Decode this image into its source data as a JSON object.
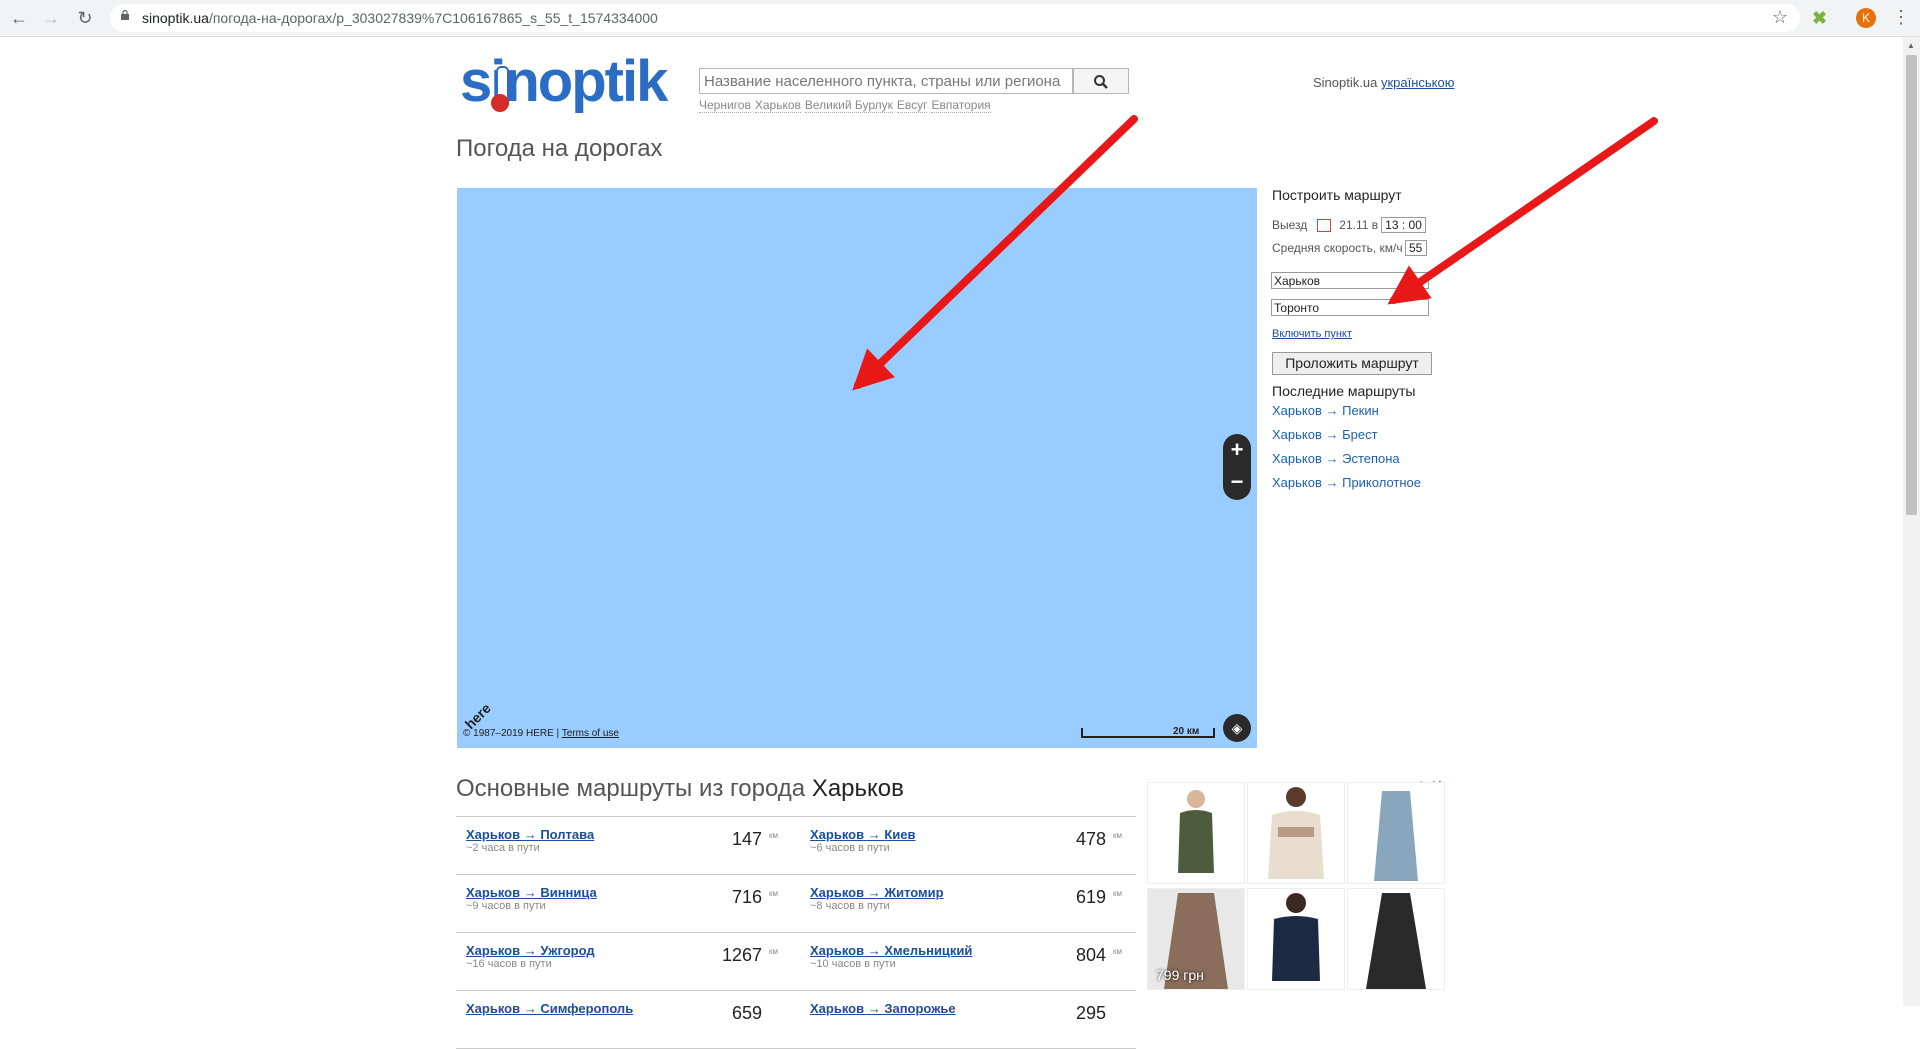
{
  "browser": {
    "url_domain": "sinoptik.ua",
    "url_path": "/погода-на-дорогах/p_303027839%7C106167865_s_55_t_1574334000",
    "profile_initial": "K"
  },
  "header": {
    "logo_text": "sinoptik",
    "search_placeholder": "Название населенного пункта, страны или региона",
    "quick_cities": [
      "Чернигов",
      "Харьков",
      "Великий Бурлук",
      "Евсуг",
      "Евпатория"
    ],
    "site_label": "Sinoptik.ua",
    "lang_link": "українською"
  },
  "page_title": "Погода на дорогах",
  "map": {
    "copyright": "© 1987–2019 HERE |",
    "terms_link": "Terms of use",
    "scale_label": "20 км",
    "here_logo": "here",
    "zoom_in": "+",
    "zoom_out": "−"
  },
  "route_form": {
    "title": "Построить маршрут",
    "depart_label": "Выезд",
    "depart_date": "21.11 в",
    "depart_hour": "13",
    "depart_sep": ":",
    "depart_min": "00",
    "speed_label": "Средняя скорость, км/ч",
    "speed_value": "55",
    "from_value": "Харьков",
    "to_value": "Торонто",
    "add_point": "Включить пункт",
    "build_button": "Проложить маршрут"
  },
  "recent": {
    "title": "Последние маршруты",
    "items": [
      "Харьков → Пекин",
      "Харьков → Брест",
      "Харьков → Эстепона",
      "Харьков → Приколотное"
    ]
  },
  "routes": {
    "title_prefix": "Основные маршруты из города",
    "title_city": "Харьков",
    "km_unit": "км",
    "rows": [
      [
        {
          "link": "Харьков → Полтава",
          "time": "~2 часа в пути",
          "dist": "147"
        },
        {
          "link": "Харьков → Киев",
          "time": "~6 часов в пути",
          "dist": "478"
        }
      ],
      [
        {
          "link": "Харьков → Винница",
          "time": "~9 часов в пути",
          "dist": "716"
        },
        {
          "link": "Харьков → Житомир",
          "time": "~8 часов в пути",
          "dist": "619"
        }
      ],
      [
        {
          "link": "Харьков → Ужгород",
          "time": "~16 часов в пути",
          "dist": "1267"
        },
        {
          "link": "Харьков → Хмельницкий",
          "time": "~10 часов в пути",
          "dist": "804"
        }
      ],
      [
        {
          "link": "Харьков → Симферополь",
          "time": "",
          "dist": "659"
        },
        {
          "link": "Харьков → Запорожье",
          "time": "",
          "dist": "295"
        }
      ]
    ]
  },
  "ads": {
    "price": "799 грн",
    "info_icon": "ⓘ",
    "close_icon": "✕"
  },
  "colors": {
    "map_water": "#99ccff",
    "link_blue": "#1b4ea0",
    "logo_blue": "#2b6cc4",
    "arrow_red": "#e81818"
  }
}
